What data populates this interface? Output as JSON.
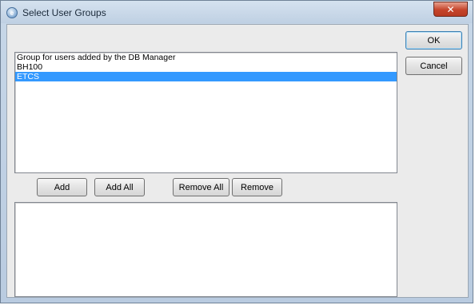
{
  "window": {
    "title": "Select User Groups",
    "close_glyph": "✕"
  },
  "buttons": {
    "ok": "OK",
    "cancel": "Cancel",
    "add": "Add",
    "add_all": "Add All",
    "remove_all": "Remove All",
    "remove": "Remove"
  },
  "available_groups": [
    {
      "label": "Group for users added by the DB Manager",
      "selected": false
    },
    {
      "label": "BH100",
      "selected": false
    },
    {
      "label": "ETCS",
      "selected": true
    }
  ],
  "selected_groups": [],
  "colors": {
    "selection": "#3399ff",
    "close_button": "#c5452b"
  }
}
